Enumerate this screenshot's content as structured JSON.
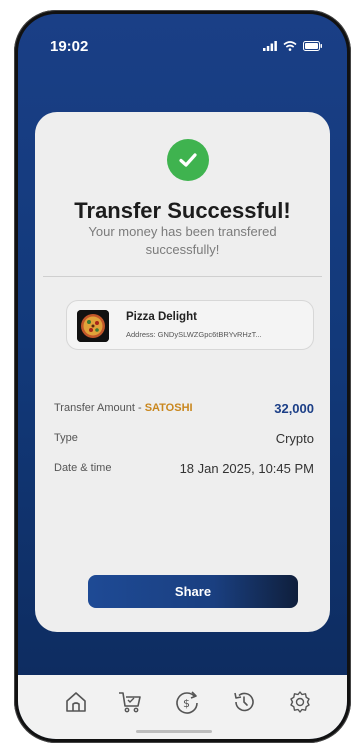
{
  "status_bar": {
    "time": "19:02"
  },
  "success": {
    "title": "Transfer Successful!",
    "subtitle": "Your money has been transfered successfully!"
  },
  "merchant": {
    "name": "Pizza Delight",
    "address": "Address: GNDySLWZGpc6tBRYvRHzT..."
  },
  "details": {
    "amount_label": "Transfer Amount -",
    "amount_token": "SATOSHI",
    "amount_value": "32,000",
    "type_label": "Type",
    "type_value": "Crypto",
    "datetime_label": "Date & time",
    "datetime_value": "18 Jan 2025, 10:45 PM"
  },
  "share_button": {
    "label": "Share"
  },
  "navigation": {
    "items": [
      {
        "icon": "home-icon"
      },
      {
        "icon": "cart-icon"
      },
      {
        "icon": "dollar-exchange-icon"
      },
      {
        "icon": "history-icon"
      },
      {
        "icon": "settings-icon"
      }
    ]
  },
  "colors": {
    "header_blue": "#1a3f86",
    "success_green": "#3fb34f",
    "token_orange": "#c9871e",
    "amount_blue": "#1c3f87"
  }
}
